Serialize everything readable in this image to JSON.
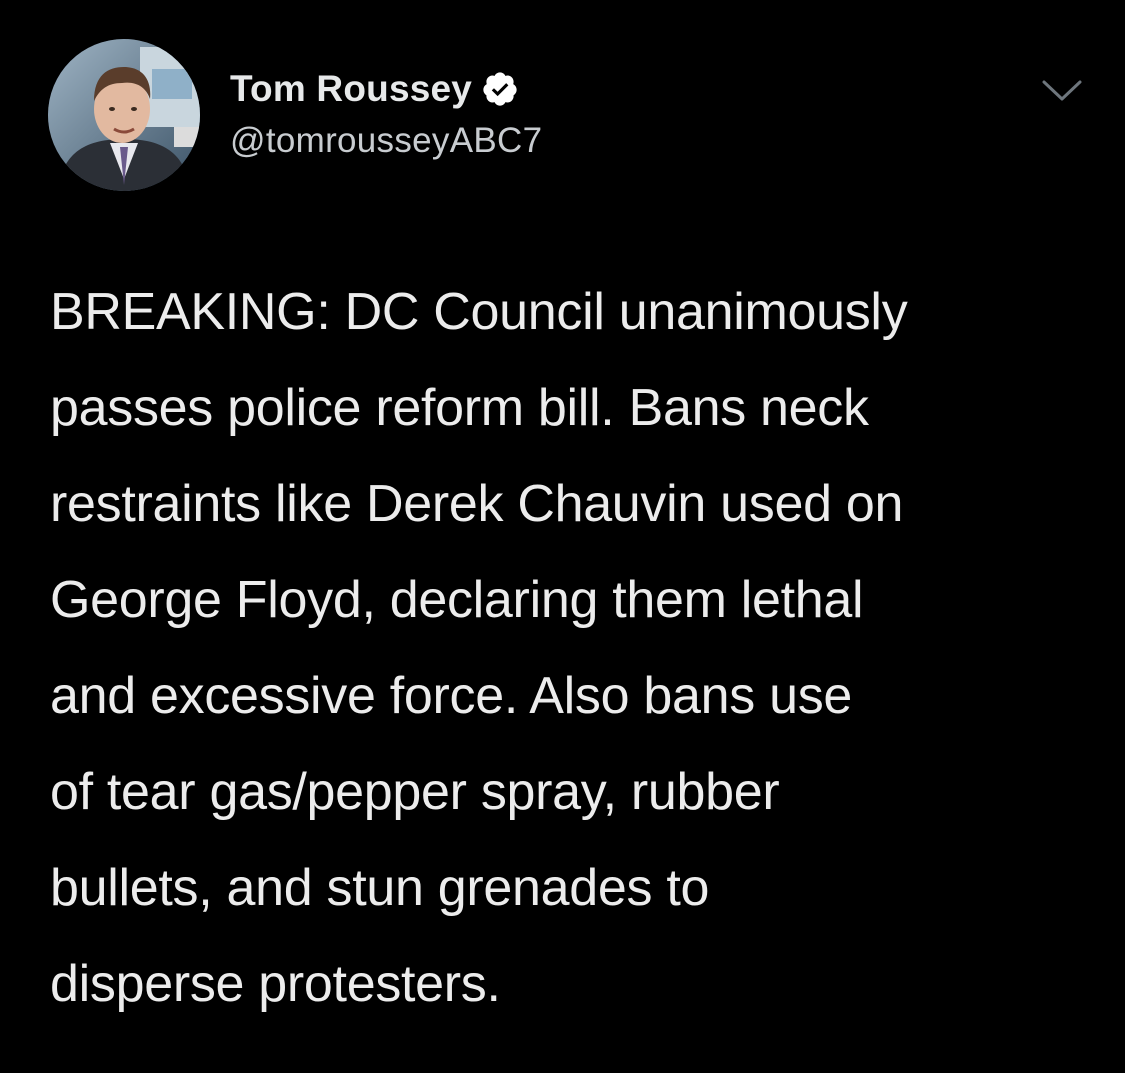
{
  "tweet": {
    "author": {
      "display_name": "Tom Roussey",
      "handle": "@tomrousseyABC7",
      "verified": true,
      "verified_icon": "verified-badge-icon",
      "avatar_icon": "profile-photo"
    },
    "menu_icon": "chevron-down-icon",
    "text": "BREAKING: DC Council unanimously\npasses police reform bill. Bans neck\nrestraints like Derek Chauvin used on\nGeorge Floyd, declaring them lethal\nand excessive force.  Also bans use\nof tear gas/pepper spray, rubber\nbullets, and stun grenades to\ndisperse protesters."
  },
  "colors": {
    "background": "#000000",
    "name": "#e7e9ea",
    "handle": "#c8ccd0",
    "body_text": "#ececec",
    "chevron": "#6e767d"
  }
}
